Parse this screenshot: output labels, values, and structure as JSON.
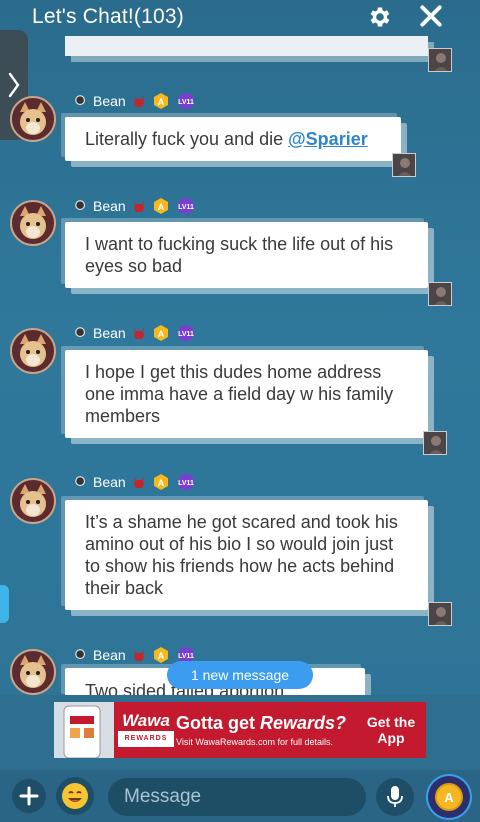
{
  "header": {
    "title": "Let's Chat!(103)",
    "settings_icon": "gear-icon",
    "close_icon": "close-icon"
  },
  "messages": [
    {
      "username": "Bean",
      "text": "Literally fuck you and die ",
      "mention": "@Sparier"
    },
    {
      "username": "Bean",
      "text": "I want to fucking suck the life out of his eyes so bad"
    },
    {
      "username": "Bean",
      "text": "I hope I get this dudes home address one imma have a field day w his family members"
    },
    {
      "username": "Bean",
      "text": "It’s a shame he got scared and took his amino out of his bio I so would join just to show his friends how he acts behind their back"
    },
    {
      "username": "Bean",
      "text": "Two sided talled abortion"
    }
  ],
  "new_message_pill": "1 new message",
  "ad": {
    "brand": "Wawa",
    "brand_sub": "REWARDS",
    "headline_pre": "Gotta get ",
    "headline_em": "Rewards?",
    "subtext": "Visit WawaRewards.com for full details.",
    "cta": "Get the App"
  },
  "composer": {
    "placeholder": "Message"
  },
  "colors": {
    "background": "#2c6f92",
    "pill": "#3b9cf0",
    "ad_red": "#c41a2f",
    "mention": "#2d86c9"
  }
}
